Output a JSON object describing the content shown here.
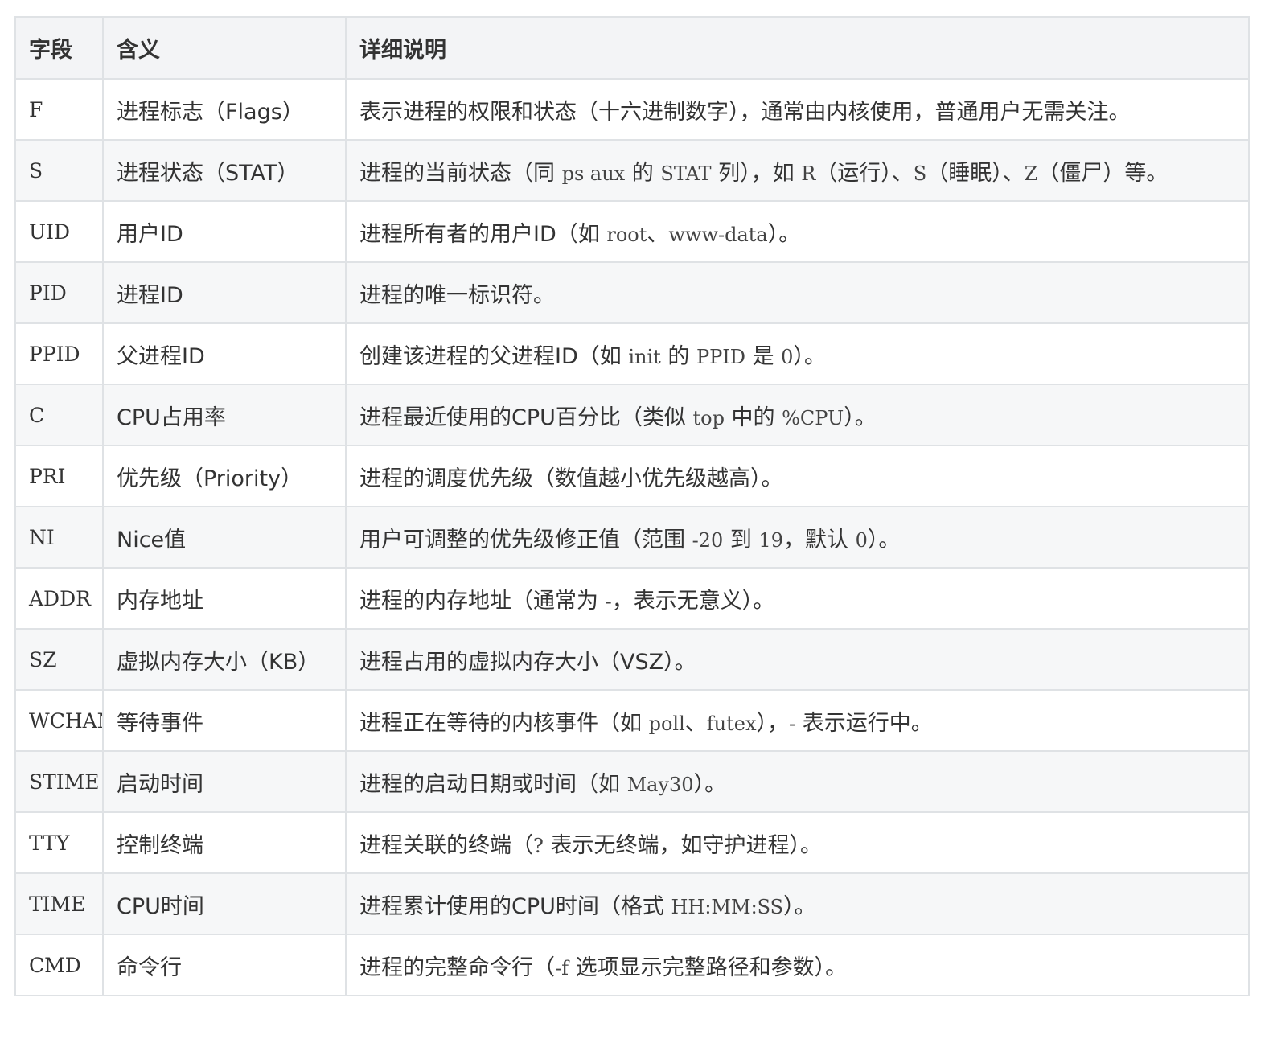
{
  "table": {
    "headers": [
      "字段",
      "含义",
      "详细说明"
    ],
    "rows": [
      {
        "field": "F",
        "meaning": "进程标志（Flags）",
        "detail": [
          {
            "t": "表示进程的权限和状态（十六进制数字），通常由内核使用，普通用户无需关注。"
          }
        ]
      },
      {
        "field": "S",
        "meaning": "进程状态（STAT）",
        "detail": [
          {
            "t": "进程的当前状态（同 "
          },
          {
            "c": "ps aux"
          },
          {
            "t": " 的 "
          },
          {
            "c": "STAT"
          },
          {
            "t": " 列），如 "
          },
          {
            "c": "R"
          },
          {
            "t": "（运行）、"
          },
          {
            "c": "S"
          },
          {
            "t": "（睡眠）、"
          },
          {
            "c": "Z"
          },
          {
            "t": "（僵尸）等。"
          }
        ]
      },
      {
        "field": "UID",
        "meaning": "用户ID",
        "detail": [
          {
            "t": "进程所有者的用户ID（如 "
          },
          {
            "c": "root"
          },
          {
            "t": "、"
          },
          {
            "c": "www-data"
          },
          {
            "t": "）。"
          }
        ]
      },
      {
        "field": "PID",
        "meaning": "进程ID",
        "detail": [
          {
            "t": "进程的唯一标识符。"
          }
        ]
      },
      {
        "field": "PPID",
        "meaning": "父进程ID",
        "detail": [
          {
            "t": "创建该进程的父进程ID（如 "
          },
          {
            "c": "init"
          },
          {
            "t": " 的 "
          },
          {
            "c": "PPID"
          },
          {
            "t": " 是 "
          },
          {
            "c": "0"
          },
          {
            "t": "）。"
          }
        ]
      },
      {
        "field": "C",
        "meaning": "CPU占用率",
        "detail": [
          {
            "t": "进程最近使用的CPU百分比（类似 "
          },
          {
            "c": "top"
          },
          {
            "t": " 中的 "
          },
          {
            "c": "%CPU"
          },
          {
            "t": "）。"
          }
        ]
      },
      {
        "field": "PRI",
        "meaning": "优先级（Priority）",
        "detail": [
          {
            "t": "进程的调度优先级（数值越小优先级越高）。"
          }
        ]
      },
      {
        "field": "NI",
        "meaning": "Nice值",
        "detail": [
          {
            "t": "用户可调整的优先级修正值（范围 "
          },
          {
            "c": "-20"
          },
          {
            "t": " 到 "
          },
          {
            "c": "19"
          },
          {
            "t": "，默认 "
          },
          {
            "c": "0"
          },
          {
            "t": "）。"
          }
        ]
      },
      {
        "field": "ADDR",
        "meaning": "内存地址",
        "detail": [
          {
            "t": "进程的内存地址（通常为 "
          },
          {
            "c": "-"
          },
          {
            "t": "，表示无意义）。"
          }
        ]
      },
      {
        "field": "SZ",
        "meaning": "虚拟内存大小（KB）",
        "detail": [
          {
            "t": "进程占用的虚拟内存大小（VSZ）。"
          }
        ]
      },
      {
        "field": "WCHAN",
        "meaning": "等待事件",
        "detail": [
          {
            "t": "进程正在等待的内核事件（如 "
          },
          {
            "c": "poll"
          },
          {
            "t": "、"
          },
          {
            "c": "futex"
          },
          {
            "t": "），"
          },
          {
            "c": "-"
          },
          {
            "t": " 表示运行中。"
          }
        ]
      },
      {
        "field": "STIME",
        "meaning": "启动时间",
        "detail": [
          {
            "t": "进程的启动日期或时间（如 "
          },
          {
            "c": "May30"
          },
          {
            "t": "）。"
          }
        ]
      },
      {
        "field": "TTY",
        "meaning": "控制终端",
        "detail": [
          {
            "t": "进程关联的终端（"
          },
          {
            "c": "?"
          },
          {
            "t": " 表示无终端，如守护进程）。"
          }
        ]
      },
      {
        "field": "TIME",
        "meaning": "CPU时间",
        "detail": [
          {
            "t": "进程累计使用的CPU时间（格式 "
          },
          {
            "c": "HH:MM:SS"
          },
          {
            "t": "）。"
          }
        ]
      },
      {
        "field": "CMD",
        "meaning": "命令行",
        "detail": [
          {
            "t": "进程的完整命令行（"
          },
          {
            "c": "-f"
          },
          {
            "t": " 选项显示完整路径和参数）。"
          }
        ]
      }
    ]
  }
}
